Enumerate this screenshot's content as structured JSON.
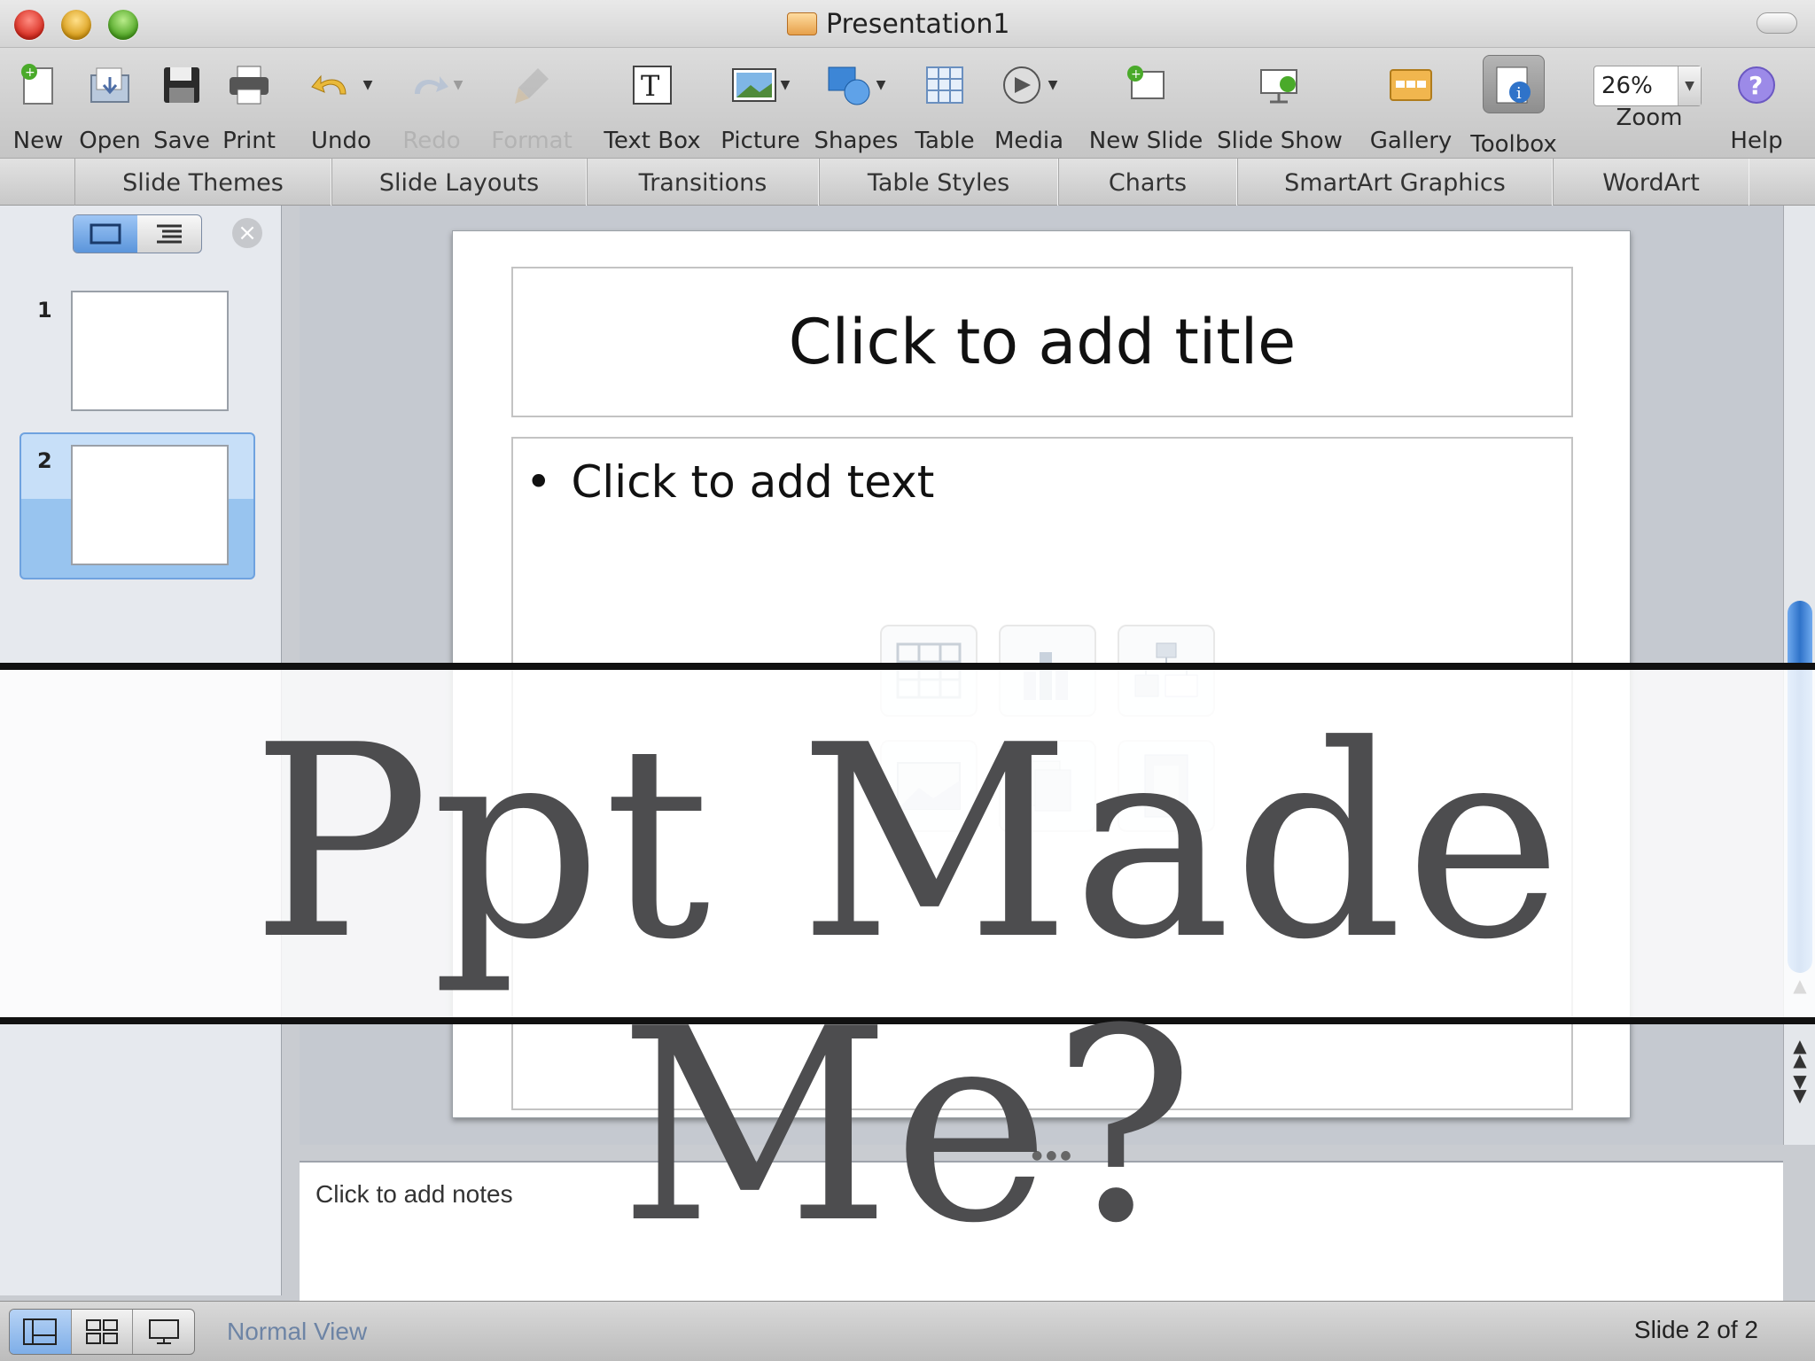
{
  "window": {
    "title": "Presentation1"
  },
  "toolbar": {
    "new": "New",
    "open": "Open",
    "save": "Save",
    "print": "Print",
    "undo": "Undo",
    "redo": "Redo",
    "format": "Format",
    "text_box": "Text Box",
    "picture": "Picture",
    "shapes": "Shapes",
    "table": "Table",
    "media": "Media",
    "new_slide": "New Slide",
    "slide_show": "Slide Show",
    "gallery": "Gallery",
    "toolbox": "Toolbox",
    "zoom_label": "Zoom",
    "zoom_value": "26%",
    "help": "Help"
  },
  "ribbon": {
    "tabs": [
      "Slide Themes",
      "Slide Layouts",
      "Transitions",
      "Table Styles",
      "Charts",
      "SmartArt Graphics",
      "WordArt"
    ]
  },
  "slides_pane": {
    "slides": [
      {
        "number": "1"
      },
      {
        "number": "2",
        "selected": true
      }
    ]
  },
  "slide": {
    "title_placeholder": "Click to add title",
    "body_placeholder": "Click to add text",
    "bullet": "•"
  },
  "notes": {
    "placeholder": "Click to add notes"
  },
  "status": {
    "view_name": "Normal View",
    "slide_count": "Slide 2 of 2"
  },
  "overlay": {
    "text": "Ppt Made Me?"
  },
  "colors": {
    "accent_blue": "#2f73c9",
    "overlay_text": "#4d4d4f"
  }
}
